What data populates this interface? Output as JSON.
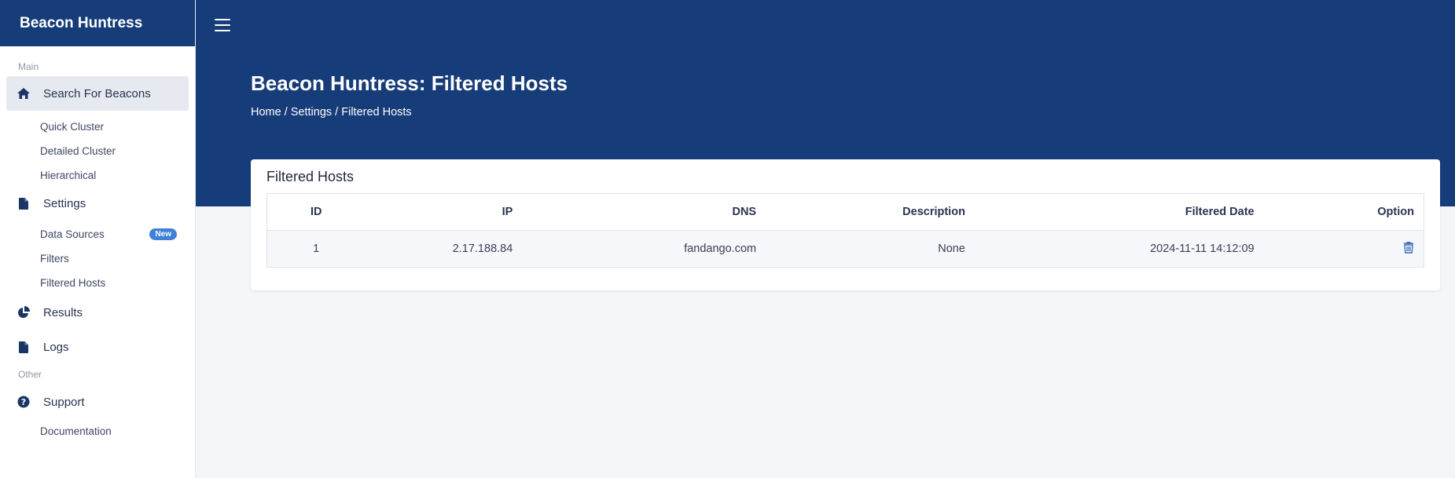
{
  "app": {
    "name": "Beacon Huntress"
  },
  "sidebar": {
    "sections": {
      "main": "Main",
      "other": "Other"
    },
    "search": {
      "label": "Search For Beacons"
    },
    "search_sub": [
      "Quick Cluster",
      "Detailed Cluster",
      "Hierarchical"
    ],
    "settings": {
      "label": "Settings"
    },
    "settings_sub": [
      "Data Sources",
      "Filters",
      "Filtered Hosts"
    ],
    "badge_new": "New",
    "results": {
      "label": "Results"
    },
    "logs": {
      "label": "Logs"
    },
    "support": {
      "label": "Support"
    },
    "support_sub": [
      "Documentation"
    ]
  },
  "header": {
    "title": "Beacon Huntress: Filtered Hosts",
    "breadcrumb": "Home / Settings / Filtered Hosts"
  },
  "card": {
    "title": "Filtered Hosts",
    "columns": [
      "ID",
      "IP",
      "DNS",
      "Description",
      "Filtered Date",
      "Option"
    ],
    "rows": [
      {
        "id": "1",
        "ip": "2.17.188.84",
        "dns": "fandango.com",
        "description": "None",
        "filtered_date": "2024-11-11 14:12:09"
      }
    ]
  },
  "colors": {
    "primary": "#163c79",
    "badge": "#3f80d8",
    "background": "#f3f5f9"
  }
}
